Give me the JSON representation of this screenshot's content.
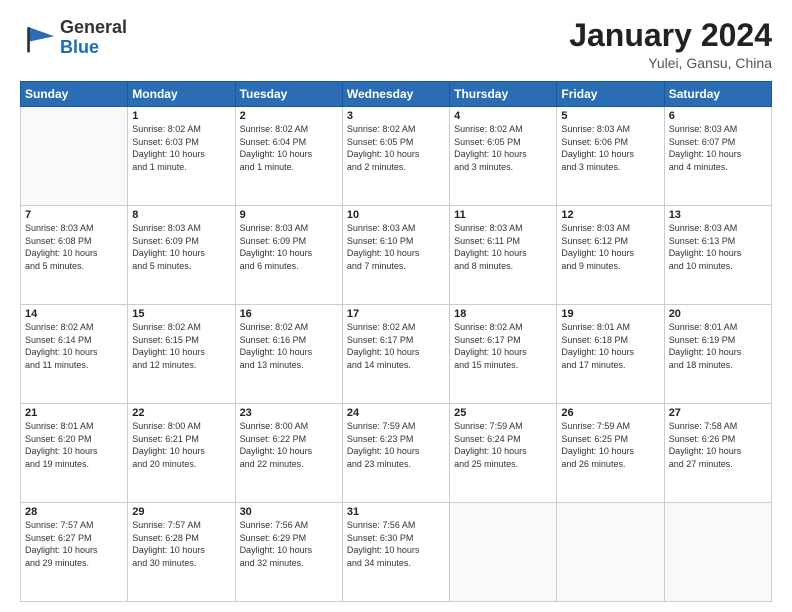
{
  "header": {
    "logo_general": "General",
    "logo_blue": "Blue",
    "month_title": "January 2024",
    "subtitle": "Yulei, Gansu, China"
  },
  "days_of_week": [
    "Sunday",
    "Monday",
    "Tuesday",
    "Wednesday",
    "Thursday",
    "Friday",
    "Saturday"
  ],
  "weeks": [
    [
      {
        "day": "",
        "info": ""
      },
      {
        "day": "1",
        "info": "Sunrise: 8:02 AM\nSunset: 6:03 PM\nDaylight: 10 hours\nand 1 minute."
      },
      {
        "day": "2",
        "info": "Sunrise: 8:02 AM\nSunset: 6:04 PM\nDaylight: 10 hours\nand 1 minute."
      },
      {
        "day": "3",
        "info": "Sunrise: 8:02 AM\nSunset: 6:05 PM\nDaylight: 10 hours\nand 2 minutes."
      },
      {
        "day": "4",
        "info": "Sunrise: 8:02 AM\nSunset: 6:05 PM\nDaylight: 10 hours\nand 3 minutes."
      },
      {
        "day": "5",
        "info": "Sunrise: 8:03 AM\nSunset: 6:06 PM\nDaylight: 10 hours\nand 3 minutes."
      },
      {
        "day": "6",
        "info": "Sunrise: 8:03 AM\nSunset: 6:07 PM\nDaylight: 10 hours\nand 4 minutes."
      }
    ],
    [
      {
        "day": "7",
        "info": "Sunrise: 8:03 AM\nSunset: 6:08 PM\nDaylight: 10 hours\nand 5 minutes."
      },
      {
        "day": "8",
        "info": "Sunrise: 8:03 AM\nSunset: 6:09 PM\nDaylight: 10 hours\nand 5 minutes."
      },
      {
        "day": "9",
        "info": "Sunrise: 8:03 AM\nSunset: 6:09 PM\nDaylight: 10 hours\nand 6 minutes."
      },
      {
        "day": "10",
        "info": "Sunrise: 8:03 AM\nSunset: 6:10 PM\nDaylight: 10 hours\nand 7 minutes."
      },
      {
        "day": "11",
        "info": "Sunrise: 8:03 AM\nSunset: 6:11 PM\nDaylight: 10 hours\nand 8 minutes."
      },
      {
        "day": "12",
        "info": "Sunrise: 8:03 AM\nSunset: 6:12 PM\nDaylight: 10 hours\nand 9 minutes."
      },
      {
        "day": "13",
        "info": "Sunrise: 8:03 AM\nSunset: 6:13 PM\nDaylight: 10 hours\nand 10 minutes."
      }
    ],
    [
      {
        "day": "14",
        "info": "Sunrise: 8:02 AM\nSunset: 6:14 PM\nDaylight: 10 hours\nand 11 minutes."
      },
      {
        "day": "15",
        "info": "Sunrise: 8:02 AM\nSunset: 6:15 PM\nDaylight: 10 hours\nand 12 minutes."
      },
      {
        "day": "16",
        "info": "Sunrise: 8:02 AM\nSunset: 6:16 PM\nDaylight: 10 hours\nand 13 minutes."
      },
      {
        "day": "17",
        "info": "Sunrise: 8:02 AM\nSunset: 6:17 PM\nDaylight: 10 hours\nand 14 minutes."
      },
      {
        "day": "18",
        "info": "Sunrise: 8:02 AM\nSunset: 6:17 PM\nDaylight: 10 hours\nand 15 minutes."
      },
      {
        "day": "19",
        "info": "Sunrise: 8:01 AM\nSunset: 6:18 PM\nDaylight: 10 hours\nand 17 minutes."
      },
      {
        "day": "20",
        "info": "Sunrise: 8:01 AM\nSunset: 6:19 PM\nDaylight: 10 hours\nand 18 minutes."
      }
    ],
    [
      {
        "day": "21",
        "info": "Sunrise: 8:01 AM\nSunset: 6:20 PM\nDaylight: 10 hours\nand 19 minutes."
      },
      {
        "day": "22",
        "info": "Sunrise: 8:00 AM\nSunset: 6:21 PM\nDaylight: 10 hours\nand 20 minutes."
      },
      {
        "day": "23",
        "info": "Sunrise: 8:00 AM\nSunset: 6:22 PM\nDaylight: 10 hours\nand 22 minutes."
      },
      {
        "day": "24",
        "info": "Sunrise: 7:59 AM\nSunset: 6:23 PM\nDaylight: 10 hours\nand 23 minutes."
      },
      {
        "day": "25",
        "info": "Sunrise: 7:59 AM\nSunset: 6:24 PM\nDaylight: 10 hours\nand 25 minutes."
      },
      {
        "day": "26",
        "info": "Sunrise: 7:59 AM\nSunset: 6:25 PM\nDaylight: 10 hours\nand 26 minutes."
      },
      {
        "day": "27",
        "info": "Sunrise: 7:58 AM\nSunset: 6:26 PM\nDaylight: 10 hours\nand 27 minutes."
      }
    ],
    [
      {
        "day": "28",
        "info": "Sunrise: 7:57 AM\nSunset: 6:27 PM\nDaylight: 10 hours\nand 29 minutes."
      },
      {
        "day": "29",
        "info": "Sunrise: 7:57 AM\nSunset: 6:28 PM\nDaylight: 10 hours\nand 30 minutes."
      },
      {
        "day": "30",
        "info": "Sunrise: 7:56 AM\nSunset: 6:29 PM\nDaylight: 10 hours\nand 32 minutes."
      },
      {
        "day": "31",
        "info": "Sunrise: 7:56 AM\nSunset: 6:30 PM\nDaylight: 10 hours\nand 34 minutes."
      },
      {
        "day": "",
        "info": ""
      },
      {
        "day": "",
        "info": ""
      },
      {
        "day": "",
        "info": ""
      }
    ]
  ]
}
